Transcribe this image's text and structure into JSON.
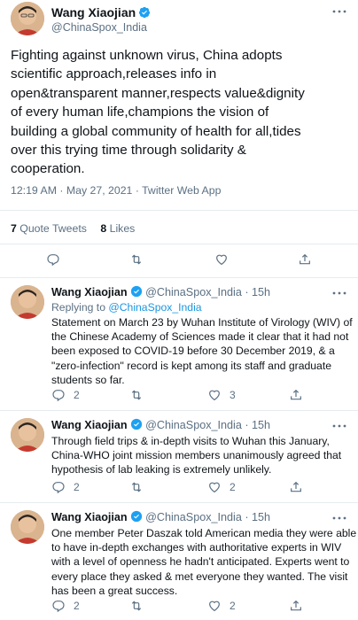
{
  "main_tweet": {
    "author_name": "Wang Xiaojian",
    "handle": "@ChinaSpox_India",
    "text": "Fighting against unknown virus, China adopts scientific approach,releases info in open&transparent manner,respects value&dignity of every human life,champions the vision of building a global community of health for all,tides over this trying time through solidarity & cooperation.",
    "text_lines": [
      "Fighting against unknown virus, China adopts",
      "scientific approach,releases info in",
      "open&transparent manner,respects value&dignity",
      "of every human life,champions the vision of",
      "building a global community of health for all,tides",
      "over this trying time through solidarity &",
      "cooperation."
    ],
    "timestamp": "12:19 AM · May 27, 2021 · Twitter Web App",
    "stats": {
      "quote_count": "7",
      "quote_label": "Quote Tweets",
      "like_count": "8",
      "like_label": "Likes"
    }
  },
  "replies": [
    {
      "author_name": "Wang Xiaojian",
      "handle_time": "@ChinaSpox_India · 15h",
      "replying_to_label": "Replying to",
      "replying_to_handle": "@ChinaSpox_India",
      "lines": [
        "Statement on March 23 by Wuhan Institute of Virology (WIV) of",
        "the Chinese Academy of Sciences made it clear that it had not",
        "been exposed to COVID-19 before 30 December 2019, & a",
        "\"zero-infection\" record is kept among its staff and graduate",
        "students so far."
      ],
      "reply_count": "2",
      "retweet_count": "",
      "like_count": "3"
    },
    {
      "author_name": "Wang Xiaojian",
      "handle_time": "@ChinaSpox_India · 15h",
      "lines": [
        "Through field trips & in-depth visits to Wuhan this January,",
        "China-WHO joint mission members unanimously agreed that",
        "hypothesis of lab leaking is extremely unlikely."
      ],
      "reply_count": "2",
      "retweet_count": "",
      "like_count": "2"
    },
    {
      "author_name": "Wang Xiaojian",
      "handle_time": "@ChinaSpox_India · 15h",
      "lines": [
        "One member Peter Daszak told American media they were able",
        "to have in-depth exchanges with authoritative experts in WIV",
        "with a level of openness he hadn't anticipated. Experts went to",
        "every place they asked & met everyone they wanted. The visit",
        "has been a great success."
      ],
      "reply_count": "2",
      "retweet_count": "",
      "like_count": "2"
    }
  ],
  "colors": {
    "accent": "#1da1f2",
    "muted": "#5b7083",
    "divider": "#e6ecf0",
    "text": "#0f1419"
  },
  "icons": [
    "more-icon",
    "verified-icon",
    "reply-icon",
    "retweet-icon",
    "like-icon",
    "share-icon"
  ]
}
